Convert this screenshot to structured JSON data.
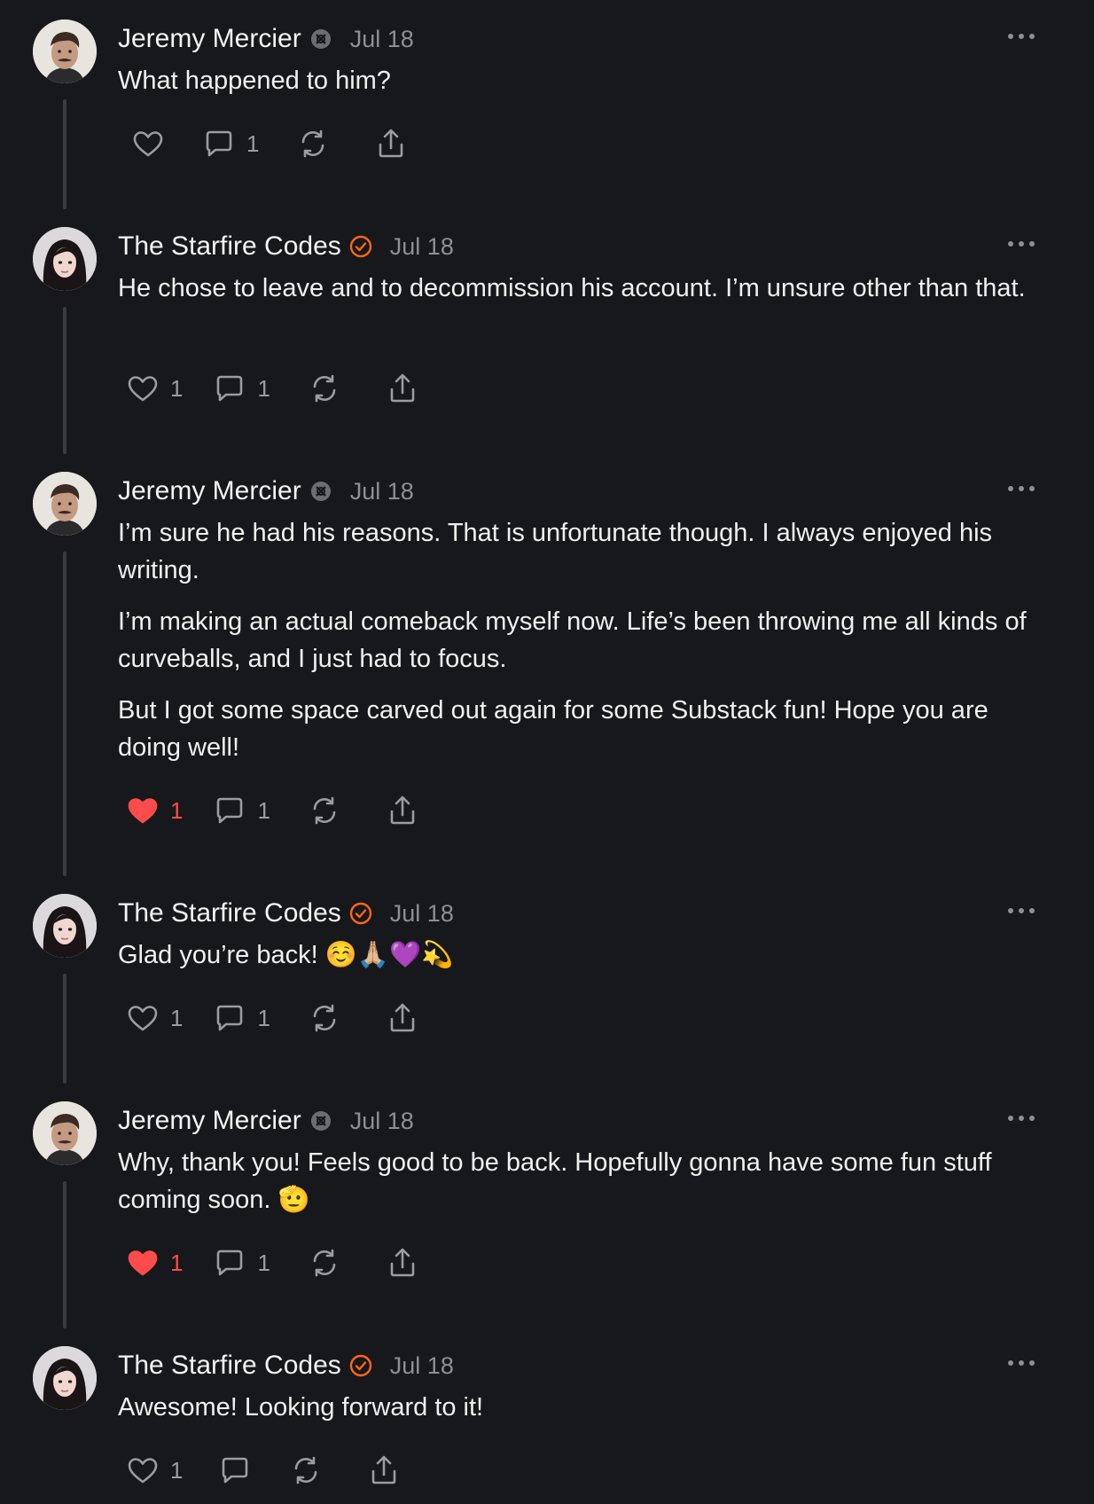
{
  "colors": {
    "background": "#17181b",
    "text": "#f2f2f2",
    "muted": "#8e8f94",
    "liked": "#ff4b4b",
    "verified_badge": "#ff6719"
  },
  "posts": [
    {
      "author": "Jeremy Mercier",
      "badge_icon": "subscriber-badge-icon",
      "date": "Jul 18",
      "paragraphs": [
        "What happened to him?"
      ],
      "like_count": "",
      "liked": false,
      "comment_count": "1"
    },
    {
      "author": "The Starfire Codes",
      "badge_icon": "verified-badge-icon",
      "date": "Jul 18",
      "paragraphs": [
        "He chose to leave and to decommission his account. I’m unsure other than that."
      ],
      "like_count": "1",
      "liked": false,
      "comment_count": "1"
    },
    {
      "author": "Jeremy Mercier",
      "badge_icon": "subscriber-badge-icon",
      "date": "Jul 18",
      "paragraphs": [
        "I’m sure he had his reasons. That is unfortunate though. I always enjoyed his writing.",
        "I’m making an actual comeback myself now. Life’s been throwing me all kinds of curveballs, and I just had to focus.",
        "But I got some space carved out again for some Substack fun! Hope you are doing well!"
      ],
      "like_count": "1",
      "liked": true,
      "comment_count": "1"
    },
    {
      "author": "The Starfire Codes",
      "badge_icon": "verified-badge-icon",
      "date": "Jul 18",
      "paragraphs": [
        "Glad you’re back! ☺️🙏🏼💜💫"
      ],
      "like_count": "1",
      "liked": false,
      "comment_count": "1"
    },
    {
      "author": "Jeremy Mercier",
      "badge_icon": "subscriber-badge-icon",
      "date": "Jul 18",
      "paragraphs": [
        "Why, thank you! Feels good to be back. Hopefully gonna have some fun stuff coming soon. 🫡"
      ],
      "like_count": "1",
      "liked": true,
      "comment_count": "1"
    },
    {
      "author": "The Starfire Codes",
      "badge_icon": "verified-badge-icon",
      "date": "Jul 18",
      "paragraphs": [
        "Awesome! Looking forward to it!"
      ],
      "like_count": "1",
      "liked": false,
      "comment_count": ""
    }
  ]
}
